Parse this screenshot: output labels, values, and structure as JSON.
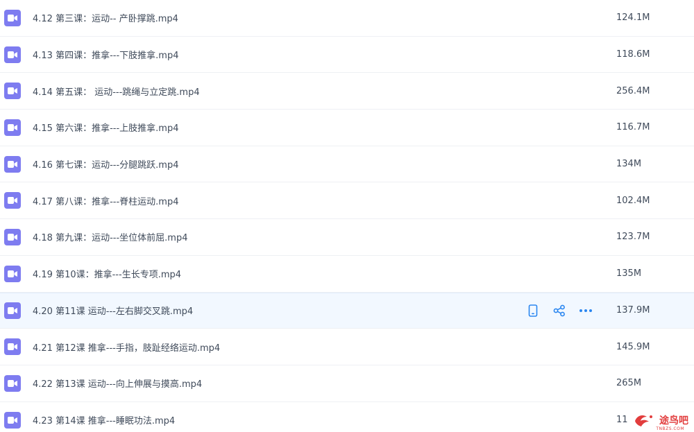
{
  "files": [
    {
      "name": "4.12 第三课：运动-- 产卧撑跳.mp4",
      "size": "124.1M"
    },
    {
      "name": "4.13 第四课：推拿---下肢推拿.mp4",
      "size": "118.6M"
    },
    {
      "name": "4.14 第五课：  运动---跳绳与立定跳.mp4",
      "size": "256.4M"
    },
    {
      "name": "4.15 第六课：推拿---上肢推拿.mp4",
      "size": "116.7M"
    },
    {
      "name": "4.16 第七课：运动---分腿跳跃.mp4",
      "size": "134M"
    },
    {
      "name": "4.17 第八课：推拿---脊柱运动.mp4",
      "size": "102.4M"
    },
    {
      "name": "4.18 第九课：运动---坐位体前屈.mp4",
      "size": "123.7M"
    },
    {
      "name": "4.19 第10课：推拿---生长专项.mp4",
      "size": "135M"
    },
    {
      "name": "4.20 第11课 运动---左右脚交叉跳.mp4",
      "size": "137.9M"
    },
    {
      "name": "4.21 第12课 推拿---手指，肢趾经络运动.mp4",
      "size": "145.9M"
    },
    {
      "name": "4.22 第13课 运动---向上伸展与摸高.mp4",
      "size": "265M"
    },
    {
      "name": "4.23 第14课 推拿---睡眠功法.mp4",
      "size": "11"
    }
  ],
  "hovered_row_index": 8,
  "row_actions": [
    "phone-icon",
    "share-icon",
    "more-icon"
  ],
  "icon": "video-file-icon",
  "colors": {
    "accent": "#2a86f0",
    "video_icon": "#7e7cf0",
    "text": "#3f4a5a",
    "hover_bg": "#f2f8ff",
    "watermark": "#e23d3d"
  },
  "watermark": {
    "text": "途鸟吧",
    "sub": "TNBZS.COM"
  }
}
